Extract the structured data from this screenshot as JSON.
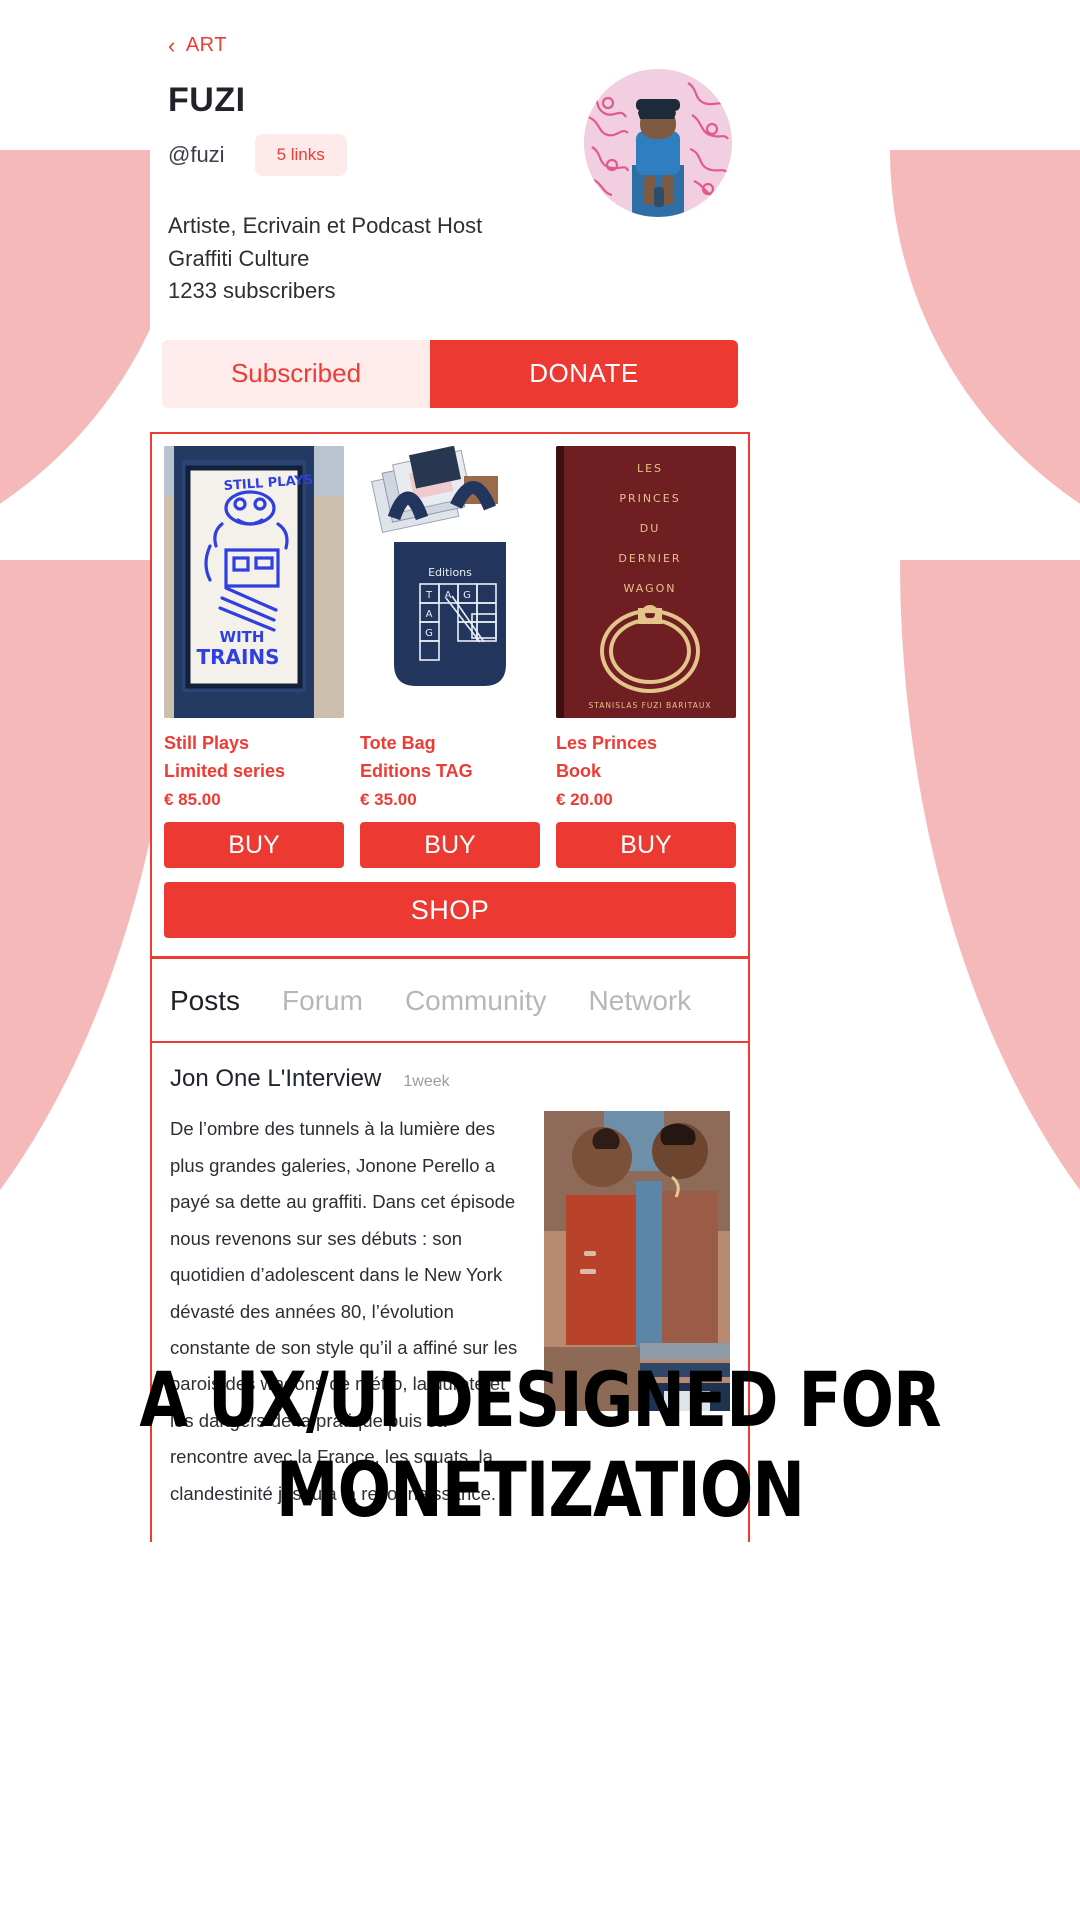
{
  "theme": {
    "accent_red": "#ee3b33",
    "button_red": "#ec3a33",
    "pale_pink": "#fdeceb",
    "bg_pink": "#f6b9b9",
    "text_dark": "#20232a",
    "text_muted": "#b6b7ba"
  },
  "nav": {
    "back_label": "ART",
    "back_icon": "chevron-left-icon"
  },
  "profile": {
    "name": "FUZI",
    "handle": "@fuzi",
    "links_badge": "5 links",
    "avatar_alt": "fuzi-avatar",
    "bio_line1": "Artiste, Ecrivain et Podcast Host",
    "bio_line2": "Graffiti Culture",
    "subscribers": "1233 subscribers"
  },
  "actions": {
    "subscribe_label": "Subscribed",
    "donate_label": "DONATE"
  },
  "shop": {
    "shop_label": "SHOP",
    "buy_label": "BUY",
    "products": [
      {
        "title_line1": "Still Plays",
        "title_line2": "Limited series",
        "price": "€ 85.00",
        "image_alt": "still-plays-print"
      },
      {
        "title_line1": "Tote Bag",
        "title_line2": "Editions TAG",
        "price": "€ 35.00",
        "image_alt": "tote-bag-editions-tag"
      },
      {
        "title_line1": "Les Princes",
        "title_line2": "Book",
        "price": "€ 20.00",
        "image_alt": "les-princes-book-cover"
      }
    ]
  },
  "book_cover": {
    "line1": "LES",
    "line2": "PRINCES",
    "line3": "DU",
    "line4": "DERNIER",
    "line5": "WAGON",
    "author": "STANISLAS FUZI BARITAUX"
  },
  "print_art": {
    "line1": "STILL PLAYS",
    "line2": "WITH",
    "line3": "TRAINS"
  },
  "tote_art": {
    "brand": "Editions",
    "letters": [
      "T",
      "A",
      "G"
    ]
  },
  "tabs": [
    {
      "label": "Posts",
      "active": true
    },
    {
      "label": "Forum",
      "active": false
    },
    {
      "label": "Community",
      "active": false
    },
    {
      "label": "Network",
      "active": false
    }
  ],
  "post": {
    "title": "Jon One L'Interview",
    "time": "1week",
    "body": "De l’ombre des tunnels à la lumière des plus grandes galeries, Jonone Perello a payé sa dette au graffiti. Dans cet épisode nous revenons sur ses débuts : son quotidien d’adolescent dans le New York dévasté des années 80, l’évolution constante de son style qu’il a affiné sur les parois des wagons de métro, la dureté et les dangers de la pratique puis sa rencontre avec la France, les squats, la clandestinité jusqu’à la reconnaissance.",
    "image_alt": "jon-one-photo"
  },
  "caption": {
    "line1": "A UX/UI DESIGNED FOR",
    "line2": "MONETIZATION"
  }
}
